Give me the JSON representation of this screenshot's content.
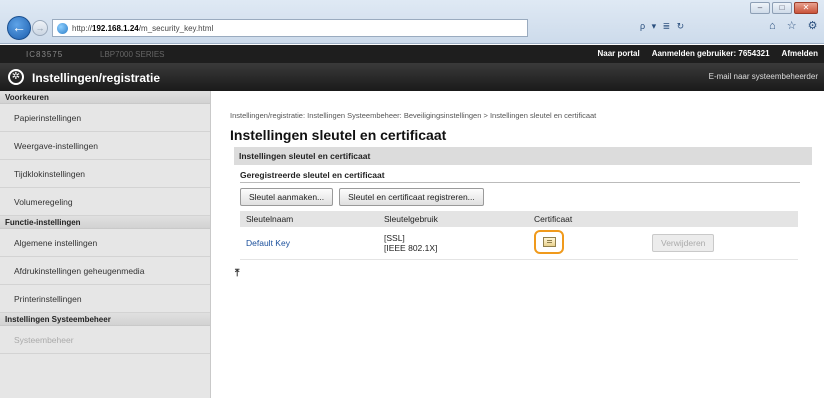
{
  "browser": {
    "url_prefix": "http://",
    "url_host": "192.168.1.24",
    "url_path": "/m_security_key.html",
    "search_glyph": "ρ ▾ ≣ ↻",
    "toolbar_glyph": "⌂ ☆ ⚙",
    "win_min": "–",
    "win_max": "□",
    "win_close": "✕"
  },
  "topbar": {
    "device_name": "IC83575",
    "device_model": "LBP7000 SERIES",
    "portal": "Naar portal",
    "user": "Aanmelden gebruiker: 7654321",
    "logout": "Afmelden"
  },
  "header": {
    "title": "Instellingen/registratie",
    "mail": "E-mail naar systeembeheerder"
  },
  "sidebar": {
    "section_prefs": "Voorkeuren",
    "prefs_items": [
      "Papierinstellingen",
      "Weergave-instellingen",
      "Tijdklokinstellingen",
      "Volumeregeling"
    ],
    "section_functions": "Functie-instellingen",
    "function_items": [
      "Algemene instellingen",
      "Afdrukinstellingen geheugenmedia",
      "Printerinstellingen"
    ],
    "section_admin": "Instellingen Systeembeheer",
    "admin_items": [
      "Systeembeheer"
    ]
  },
  "main": {
    "breadcrumb": "Instellingen/registratie: Instellingen Systeembeheer: Beveiligingsinstellingen > Instellingen sleutel en certificaat",
    "title": "Instellingen sleutel en certificaat",
    "section_title": "Instellingen sleutel en certificaat",
    "subsection_title": "Geregistreerde sleutel en certificaat",
    "btn_generate": "Sleutel aanmaken...",
    "btn_register": "Sleutel en certificaat registreren...",
    "table": {
      "headers": [
        "Sleutelnaam",
        "Sleutelgebruik",
        "Certificaat",
        ""
      ],
      "rows": [
        {
          "key_name": "Default Key",
          "usage_1": "[SSL]",
          "usage_2": "[IEEE 802.1X]",
          "delete_label": "Verwijderen"
        }
      ]
    },
    "top_anchor": "⤒"
  }
}
